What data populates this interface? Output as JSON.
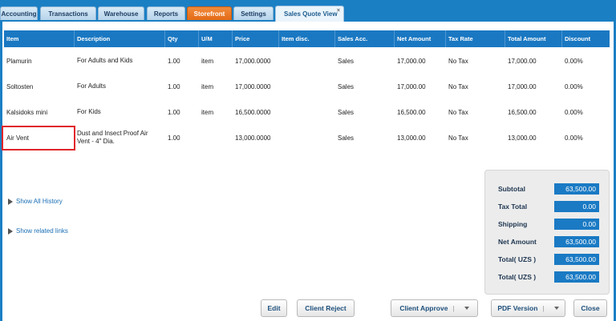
{
  "tabs": [
    {
      "label": "Accounting"
    },
    {
      "label": "Transactions"
    },
    {
      "label": "Warehouse"
    },
    {
      "label": "Reports"
    },
    {
      "label": "Storefront"
    },
    {
      "label": "Settings"
    },
    {
      "label": "Sales Quote View",
      "close": "×"
    }
  ],
  "table": {
    "headers": [
      "Item",
      "Description",
      "Qty",
      "U/M",
      "Price",
      "Item disc.",
      "Sales Acc.",
      "Net Amount",
      "Tax Rate",
      "Total Amount",
      "Discount"
    ],
    "rows": [
      {
        "item": "Plamurin",
        "desc1": "For Adults and Kids",
        "desc2": "",
        "qty": "1.00",
        "um": "item",
        "price": "17,000.0000",
        "disc": "",
        "acc": "Sales",
        "net": "17,000.00",
        "tax": "No Tax",
        "total": "17,000.00",
        "discount": "0.00%"
      },
      {
        "item": "Soltosten",
        "desc1": "For Adults",
        "desc2": "",
        "qty": "1.00",
        "um": "item",
        "price": "17,000.0000",
        "disc": "",
        "acc": "Sales",
        "net": "17,000.00",
        "tax": "No Tax",
        "total": "17,000.00",
        "discount": "0.00%"
      },
      {
        "item": "Kalsidoks mini",
        "desc1": "For Kids",
        "desc2": "",
        "qty": "1.00",
        "um": "item",
        "price": "16,500.0000",
        "disc": "",
        "acc": "Sales",
        "net": "16,500.00",
        "tax": "No Tax",
        "total": "16,500.00",
        "discount": "0.00%"
      },
      {
        "item": "Air Vent",
        "desc1": "Dust and Insect Proof Air",
        "desc2": "Vent - 4\" Dia.",
        "qty": "1.00",
        "um": "",
        "price": "13,000.0000",
        "disc": "",
        "acc": "Sales",
        "net": "13,000.00",
        "tax": "No Tax",
        "total": "13,000.00",
        "discount": "0.00%"
      }
    ]
  },
  "links": {
    "history": "Show All History",
    "related": "Show related links"
  },
  "totals": {
    "subtotal_label": "Subtotal",
    "subtotal": "63,500.00",
    "tax_label": "Tax Total",
    "tax": "0.00",
    "shipping_label": "Shipping",
    "shipping": "0.00",
    "net_label": "Net Amount",
    "net": "63,500.00",
    "total1_label": "Total( UZS )",
    "total1": "63,500.00",
    "total2_label": "Total( UZS )",
    "total2": "63,500.00"
  },
  "buttons": {
    "edit": "Edit",
    "reject": "Client Reject",
    "approve": "Client Approve",
    "pdf": "PDF Version",
    "close": "Close"
  },
  "colors": {
    "accent": "#1a78c2",
    "storefront_tab": "#e36a15",
    "highlight": "#e0242b"
  }
}
